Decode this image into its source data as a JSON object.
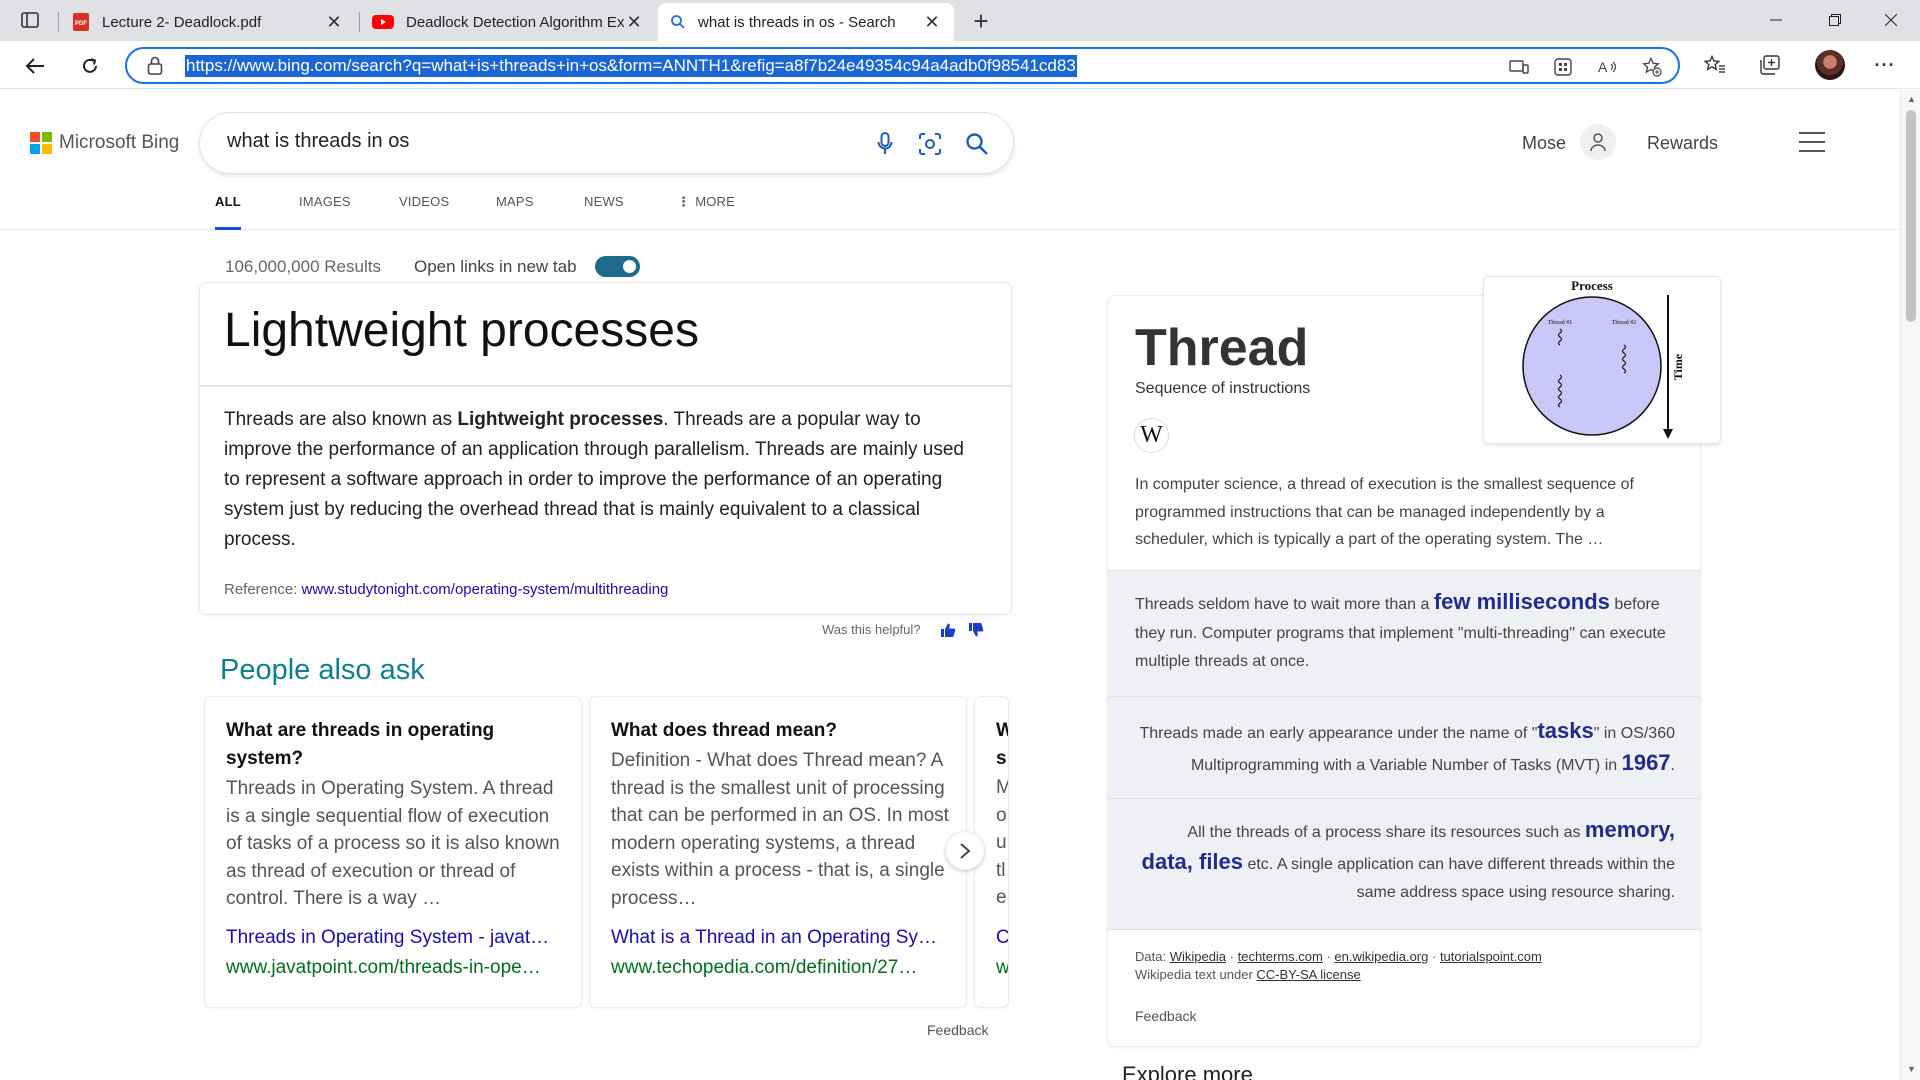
{
  "browser": {
    "tabs": [
      {
        "title": "Lecture 2- Deadlock.pdf",
        "icon": "pdf-icon"
      },
      {
        "title": "Deadlock Detection Algorithm Ex",
        "icon": "youtube-icon"
      },
      {
        "title": "what is threads in os - Search",
        "icon": "search-icon"
      }
    ],
    "new_tab_glyph": "+",
    "close_glyph": "✕",
    "url": "https://www.bing.com/search?q=what+is+threads+in+os&form=ANNTH1&refig=a8f7b24e49354c94a4adb0f98541cd83",
    "more_glyph": "···"
  },
  "bing": {
    "brand": "Microsoft Bing",
    "logo_colors": [
      "#f25022",
      "#7fba00",
      "#00a4ef",
      "#ffb900"
    ],
    "query": "what is threads in os",
    "user_name": "Mose",
    "rewards": "Rewards",
    "scopes": [
      "ALL",
      "IMAGES",
      "VIDEOS",
      "MAPS",
      "NEWS",
      "MORE"
    ],
    "accent_color": "#174ae4"
  },
  "results": {
    "count": "106,000,000 Results",
    "open_links_label": "Open links in new tab",
    "toggle_on": true
  },
  "answer": {
    "title": "Lightweight processes",
    "text_pre": "Threads are also known as ",
    "text_bold": "Lightweight processes",
    "text_post": ". Threads are a popular way to improve the performance of an application through parallelism. Threads are mainly used to represent a software approach in order to improve the performance of an operating system just by reducing the overhead thread that is mainly equivalent to a classical process.",
    "reference_label": "Reference: ",
    "reference_url": "www.studytonight.com/operating-system/multithreading",
    "helpful": "Was this helpful?"
  },
  "paa": {
    "title": "People also ask",
    "cards": [
      {
        "question": "What are threads in operating system?",
        "answer": "Threads in Operating System. A thread is a single sequential flow of execution of tasks of a process so it is also known as thread of execution or thread of control. There is a way …",
        "link": "Threads in Operating System - javat…",
        "url": "www.javatpoint.com/threads-in-ope…"
      },
      {
        "question": "What does thread mean?",
        "answer": "Definition - What does Thread mean? A thread is the smallest unit of processing that can be performed in an OS. In most modern operating systems, a thread exists within a process - that is, a single process…",
        "link": "What is a Thread in an Operating Sy…",
        "url": "www.techopedia.com/definition/27…"
      },
      {
        "question": "W s",
        "answer": "M o u tl e",
        "link": "C",
        "url": "w"
      }
    ],
    "feedback": "Feedback"
  },
  "knowledge": {
    "title": "Thread",
    "subtitle": "Sequence of instructions",
    "wiki_glyph": "W",
    "description": "In computer science, a thread of execution is the smallest sequence of programmed instructions that can be managed independently by a scheduler, which is typically a part of the operating system. The …",
    "facts": [
      {
        "pre": "Threads seldom have to wait more than a ",
        "hl": "few milliseconds",
        "post": " before they run. Computer programs that implement \"multi-threading\" can execute multiple threads at once."
      },
      {
        "pre": "Threads made an early appearance under the name of \"",
        "hl": "tasks",
        "mid": "\" in OS/360 Multiprogramming with a Variable Number of Tasks (MVT) in ",
        "hl2": "1967",
        "post": "."
      },
      {
        "pre": "All the threads of a process share its resources such as ",
        "hl": "memory, data, files",
        "post": " etc. A single application can have different threads within the same address space using resource sharing."
      }
    ],
    "data_label": "Data: ",
    "sources": [
      "Wikipedia",
      "techterms.com",
      "en.wikipedia.org",
      "tutorialspoint.com"
    ],
    "license_pre": "Wikipedia text under ",
    "license": "CC-BY-SA license",
    "feedback": "Feedback",
    "diagram": {
      "title": "Process",
      "thread1": "Thread #1",
      "thread2": "Thread #2",
      "time": "Time"
    },
    "explore_more": "Explore more"
  }
}
